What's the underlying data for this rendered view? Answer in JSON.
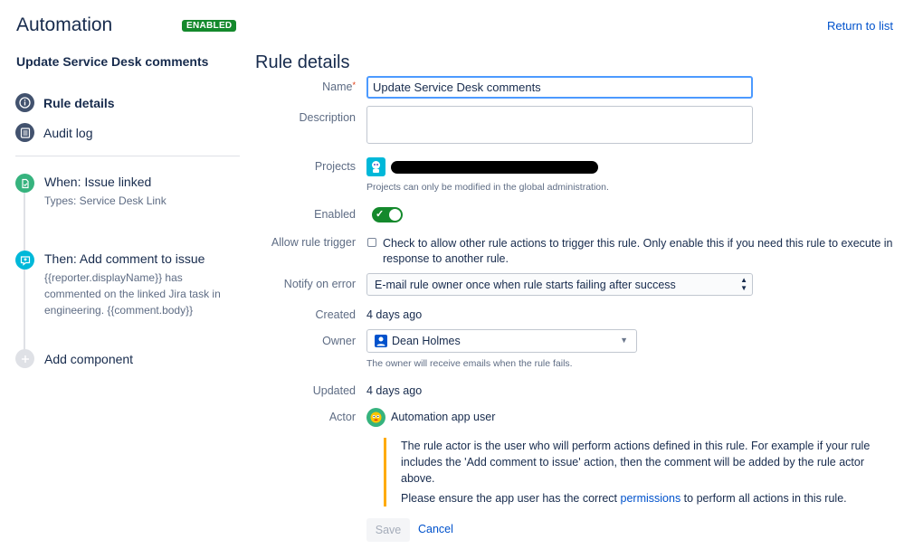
{
  "header": {
    "title": "Automation",
    "badge": "ENABLED",
    "return_link": "Return to list"
  },
  "sidebar": {
    "rule_name": "Update Service Desk comments",
    "nav": [
      {
        "label": "Rule details",
        "icon": "info-icon",
        "active": true
      },
      {
        "label": "Audit log",
        "icon": "list-icon",
        "active": false
      }
    ],
    "steps": [
      {
        "title": "When: Issue linked",
        "desc": "Types: Service Desk Link",
        "icon": "trigger-icon",
        "color": "#36b37e"
      },
      {
        "title": "Then: Add comment to issue",
        "desc": "{{reporter.displayName}} has commented on the linked Jira task in engineering. {{comment.body}}",
        "icon": "comment-icon",
        "color": "#00b8d9"
      }
    ],
    "add_component": "Add component"
  },
  "main": {
    "heading": "Rule details",
    "labels": {
      "name": "Name",
      "description": "Description",
      "projects": "Projects",
      "enabled": "Enabled",
      "allow_trigger": "Allow rule trigger",
      "notify": "Notify on error",
      "created": "Created",
      "owner": "Owner",
      "updated": "Updated",
      "actor": "Actor"
    },
    "name_value": "Update Service Desk comments",
    "description_value": "",
    "projects_hint": "Projects can only be modified in the global administration.",
    "enabled": true,
    "allow_trigger_text": "Check to allow other rule actions to trigger this rule. Only enable this if you need this rule to execute in response to another rule.",
    "notify_value": "E-mail rule owner once when rule starts failing after success",
    "created_value": "4 days ago",
    "owner_value": "Dean Holmes",
    "owner_hint": "The owner will receive emails when the rule fails.",
    "updated_value": "4 days ago",
    "actor_value": "Automation app user",
    "info_p1": "The rule actor is the user who will perform actions defined in this rule. For example if your rule includes the 'Add comment to issue' action, then the comment will be added by the rule actor above.",
    "info_p2_before": "Please ensure the app user has the correct ",
    "info_p2_link": "permissions",
    "info_p2_after": " to perform all actions in this rule.",
    "save_label": "Save",
    "cancel_label": "Cancel"
  },
  "colors": {
    "accent": "#0052cc",
    "enabled_green": "#14892c",
    "warning_border": "#ffab00"
  }
}
